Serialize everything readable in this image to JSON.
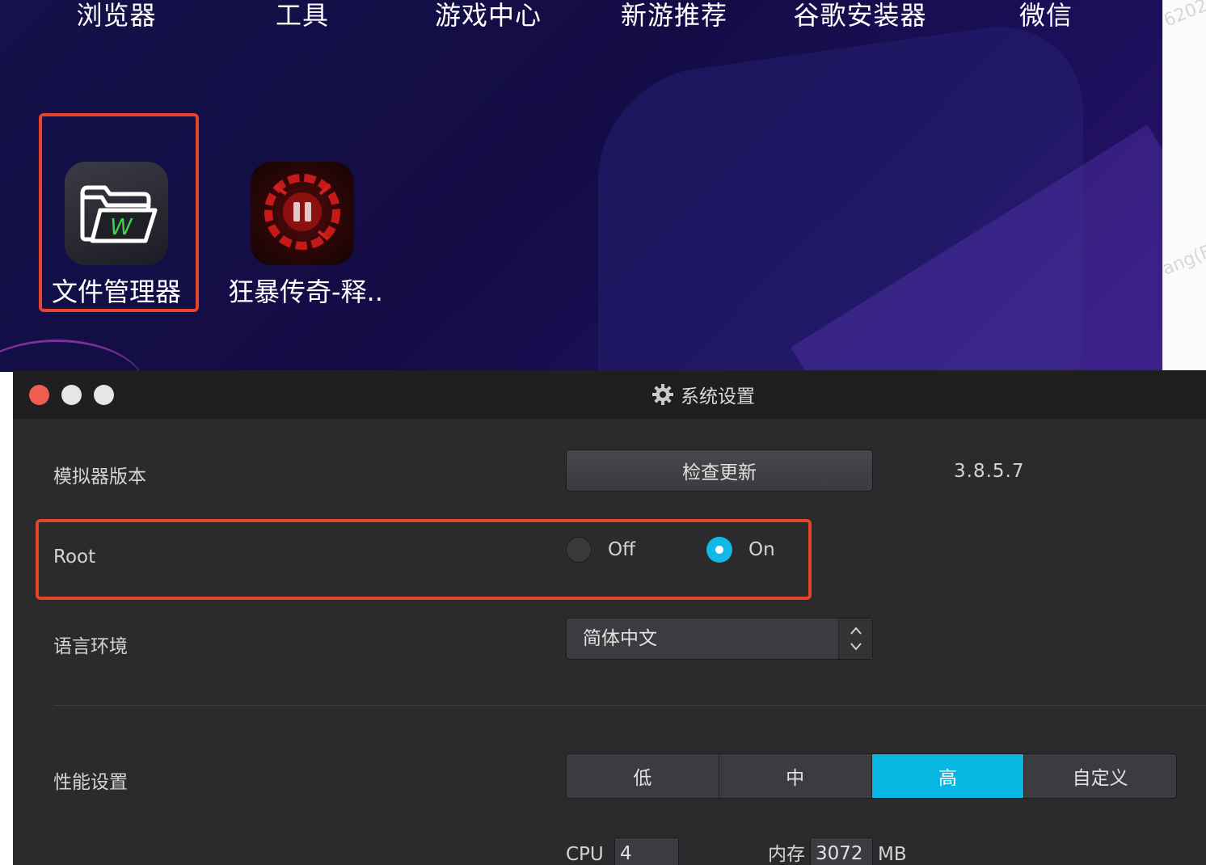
{
  "desktop": {
    "dock": [
      "浏览器",
      "工具",
      "游戏中心",
      "新游推荐",
      "谷歌安装器",
      "微信"
    ],
    "apps": [
      {
        "label": "文件管理器",
        "icon": "file-manager-icon",
        "highlighted": true
      },
      {
        "label": "狂暴传奇-释..",
        "icon": "game-icon",
        "highlighted": false
      }
    ]
  },
  "right_strip": {
    "text_top": "6202",
    "text_bottom": "ang(F"
  },
  "window": {
    "title": "系统设置",
    "title_icon": "gear-icon",
    "traffic_lights": {
      "close": "#ee5d50",
      "minimize": "#e6e6e6",
      "maximize": "#e6e6e6"
    }
  },
  "settings": {
    "version": {
      "label": "模拟器版本",
      "button": "检查更新",
      "value": "3.8.5.7"
    },
    "root": {
      "label": "Root",
      "options": [
        "Off",
        "On"
      ],
      "selected": "On",
      "highlighted": true
    },
    "language": {
      "label": "语言环境",
      "value": "简体中文"
    },
    "performance": {
      "label": "性能设置",
      "options": [
        "低",
        "中",
        "高",
        "自定义"
      ],
      "selected": "高",
      "cpu_label": "CPU",
      "cpu_value": "4",
      "memory_label": "内存",
      "memory_value": "3072",
      "memory_unit": "MB"
    }
  },
  "colors": {
    "accent": "#08b6e2",
    "highlight_border": "#e8442c",
    "window_bg": "#2b2b2e",
    "titlebar_bg": "#1f1f21"
  }
}
